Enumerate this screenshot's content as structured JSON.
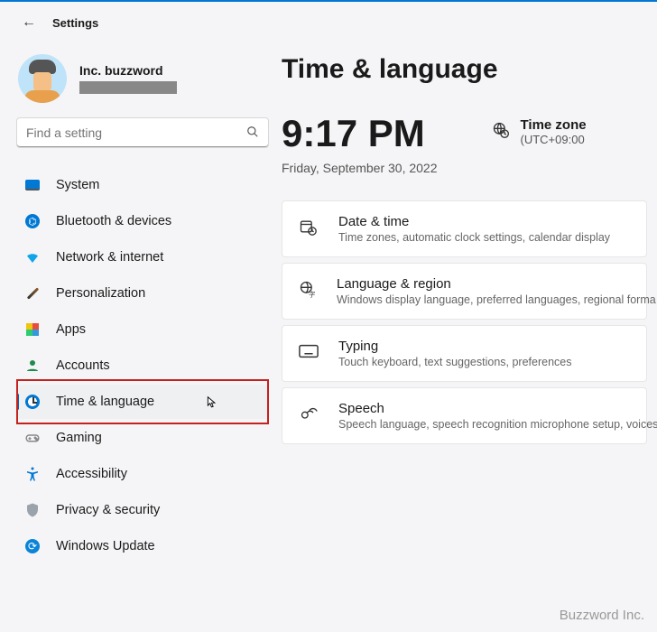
{
  "app_title": "Settings",
  "profile": {
    "name": "Inc. buzzword"
  },
  "search": {
    "placeholder": "Find a setting"
  },
  "nav": [
    {
      "key": "system",
      "label": "System"
    },
    {
      "key": "bluetooth",
      "label": "Bluetooth & devices"
    },
    {
      "key": "network",
      "label": "Network & internet"
    },
    {
      "key": "personalization",
      "label": "Personalization"
    },
    {
      "key": "apps",
      "label": "Apps"
    },
    {
      "key": "accounts",
      "label": "Accounts"
    },
    {
      "key": "time",
      "label": "Time & language",
      "selected": true
    },
    {
      "key": "gaming",
      "label": "Gaming"
    },
    {
      "key": "accessibility",
      "label": "Accessibility"
    },
    {
      "key": "privacy",
      "label": "Privacy & security"
    },
    {
      "key": "update",
      "label": "Windows Update"
    }
  ],
  "page": {
    "title": "Time & language",
    "clock": {
      "time": "9:17 PM",
      "date": "Friday, September 30, 2022"
    },
    "timezone": {
      "label": "Time zone",
      "value": "(UTC+09:00"
    }
  },
  "cards": [
    {
      "icon": "datetime",
      "title": "Date & time",
      "sub": "Time zones, automatic clock settings, calendar display"
    },
    {
      "icon": "language",
      "title": "Language & region",
      "sub": "Windows display language, preferred languages, regional forma"
    },
    {
      "icon": "typing",
      "title": "Typing",
      "sub": "Touch keyboard, text suggestions, preferences"
    },
    {
      "icon": "speech",
      "title": "Speech",
      "sub": "Speech language, speech recognition microphone setup, voices"
    }
  ],
  "watermark": "Buzzword Inc."
}
